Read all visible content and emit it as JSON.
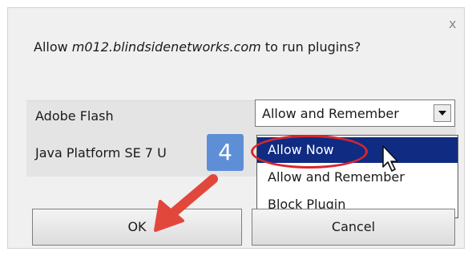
{
  "dialog": {
    "close_glyph": "x",
    "prompt_prefix": "Allow ",
    "prompt_domain": "m012.blindsidenetworks.com",
    "prompt_suffix": " to run plugins?"
  },
  "plugins": [
    {
      "name": "Adobe Flash",
      "setting": "Allow and Remember"
    },
    {
      "name": "Java Platform SE 7 U"
    }
  ],
  "dropdown": {
    "options": [
      "Allow Now",
      "Allow and Remember",
      "Block Plugin"
    ],
    "selected_index": 0
  },
  "annotation": {
    "step_badge": "4",
    "highlight_color": "#d8262e",
    "arrow_color": "#e2473c",
    "badge_color": "#5e8fd6"
  },
  "buttons": {
    "ok_label": "OK",
    "cancel_label": "Cancel"
  },
  "icons": [
    "close-icon",
    "dropdown-arrow-icon",
    "mouse-cursor-icon",
    "callout-arrow-icon"
  ]
}
